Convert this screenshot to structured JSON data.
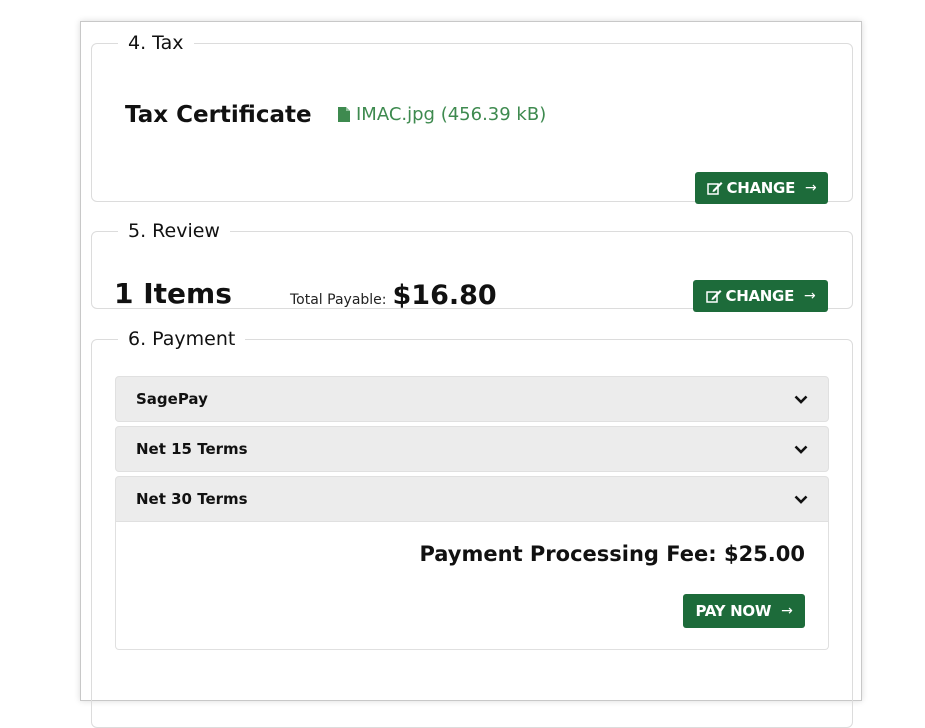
{
  "tax": {
    "legend": "4. Tax",
    "certificate_label": "Tax Certificate",
    "file_name": "IMAC.jpg (456.39 kB)",
    "change_label": "CHANGE"
  },
  "review": {
    "legend": "5. Review",
    "items_count": "1 Items",
    "total_label": "Total Payable:",
    "total_value": "$16.80",
    "change_label": "CHANGE"
  },
  "payment": {
    "legend": "6. Payment",
    "methods": [
      {
        "label": "SagePay",
        "expanded": false
      },
      {
        "label": "Net 15 Terms",
        "expanded": false
      },
      {
        "label": "Net 30 Terms",
        "expanded": true
      }
    ],
    "processing_fee": "Payment Processing Fee: $25.00",
    "pay_now_label": "PAY NOW"
  },
  "colors": {
    "button_green": "#1d6b3a",
    "link_green": "#3e8a4f",
    "accordion_bg": "#ececec"
  },
  "icons": {
    "change": "edit-icon",
    "arrow": "arrow-right-icon",
    "file": "file-icon",
    "chevron": "chevron-down-icon"
  }
}
